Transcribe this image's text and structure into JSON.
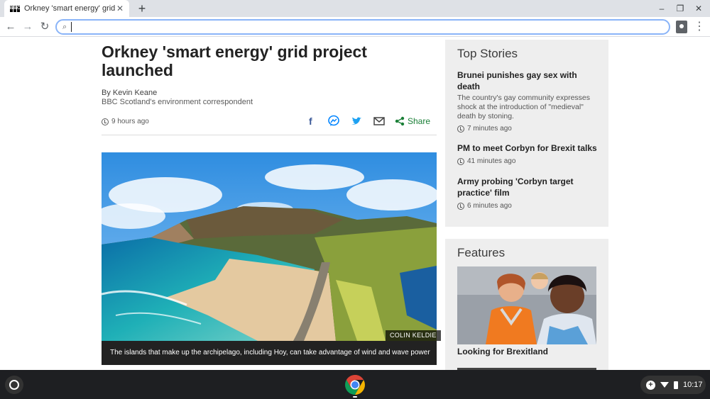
{
  "browser": {
    "tab_title": "Orkney 'smart energy' grid projec",
    "favicon": [
      "B",
      "B",
      "C"
    ],
    "close_glyph": "✕",
    "new_tab_glyph": "+",
    "win_min": "–",
    "win_restore": "❐",
    "win_close": "✕",
    "back_glyph": "←",
    "forward_glyph": "→",
    "reload_glyph": "↻",
    "search_glyph": "⌕",
    "omnibox_value": "",
    "menu_glyph": "⋮"
  },
  "article": {
    "headline": "Orkney 'smart energy' grid project launched",
    "author": "By Kevin Keane",
    "role": "BBC Scotland's environment correspondent",
    "time": "9 hours ago",
    "share_label": "Share",
    "image_credit": "COLIN KELDIE",
    "caption": "The islands that make up the archipelago, including Hoy, can take advantage of wind and wave power"
  },
  "sidebar": {
    "top_stories_title": "Top Stories",
    "stories": [
      {
        "headline": "Brunei punishes gay sex with death",
        "summary": "The country's gay community expresses shock at the introduction of \"medieval\" death by stoning.",
        "time": "7 minutes ago"
      },
      {
        "headline": "PM to meet Corbyn for Brexit talks",
        "time": "41 minutes ago"
      },
      {
        "headline": "Army probing 'Corbyn target practice' film",
        "time": "6 minutes ago"
      }
    ],
    "features_title": "Features",
    "feature_headline": "Looking for Brexitland"
  },
  "shelf": {
    "clock": "10:17",
    "tray_plus": "+"
  },
  "colors": {
    "facebook": "#3b5998",
    "messenger": "#0084ff",
    "twitter": "#1da1f2",
    "share_green": "#1a7f37",
    "omnibox_focus": "#8ab4f8"
  },
  "icons": [
    "facebook-icon",
    "messenger-icon",
    "twitter-icon",
    "email-icon",
    "share-icon",
    "clock-icon",
    "chrome-icon",
    "wifi-icon",
    "battery-icon"
  ]
}
